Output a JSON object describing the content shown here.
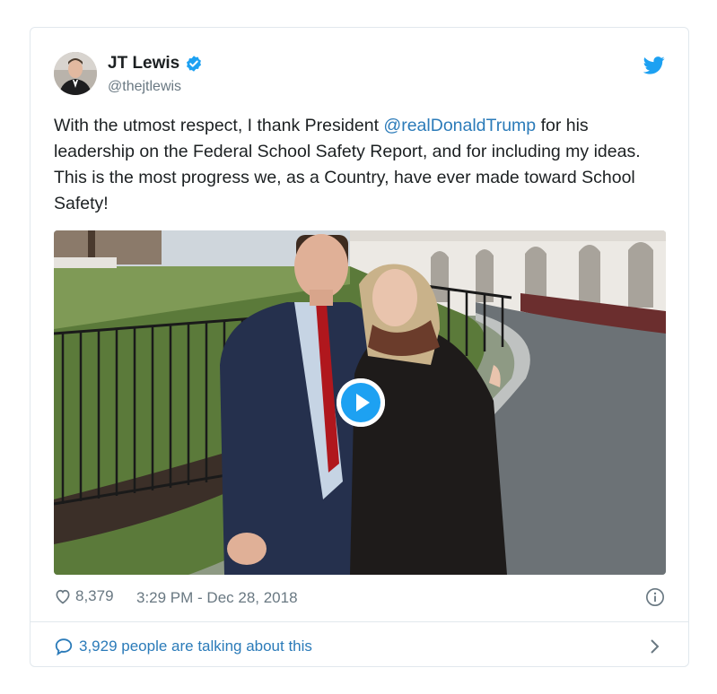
{
  "author": {
    "display_name": "JT Lewis",
    "handle": "@thejtlewis",
    "verified": true,
    "avatar_icon": "user-avatar"
  },
  "tweet": {
    "text_before": "With the utmost respect, I thank President ",
    "mention": "@realDonaldTrump",
    "text_after": " for his leadership on the Federal School Safety Report, and for including my ideas. This is the most progress we, as a Country, have ever made toward School Safety!"
  },
  "media": {
    "type": "video",
    "play_icon": "play-icon"
  },
  "footer": {
    "like_count": "8,379",
    "timestamp": "3:29 PM - Dec 28, 2018"
  },
  "conversation": {
    "label": "3,929 people are talking about this"
  },
  "colors": {
    "link": "#2b7bb9",
    "twitter_blue": "#1da1f2",
    "muted": "#697882",
    "border": "#e1e8ed"
  }
}
